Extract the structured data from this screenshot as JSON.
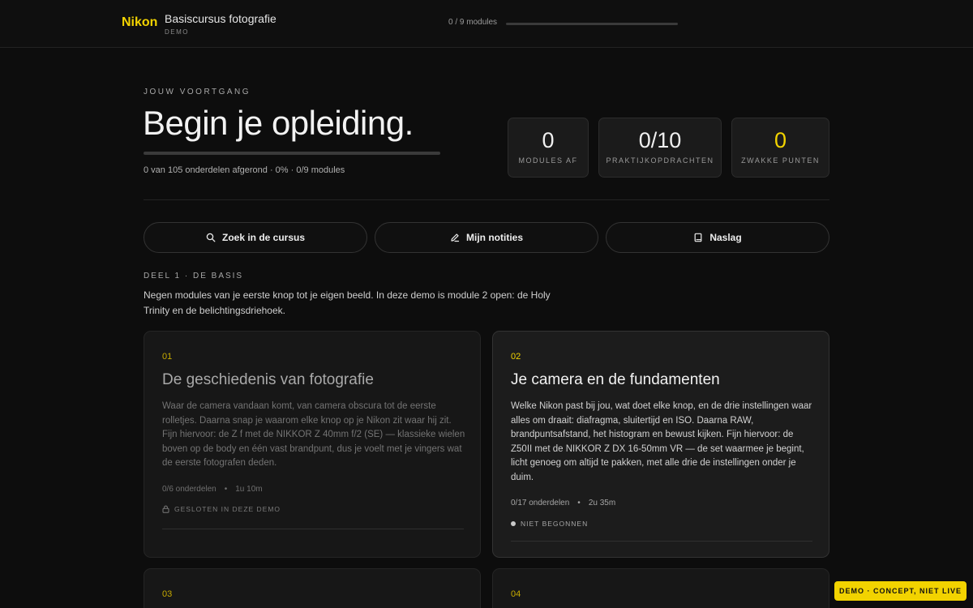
{
  "header": {
    "brand": "Nikon",
    "course_title": "Basiscursus fotografie",
    "course_sub": "DEMO",
    "progress_label": "0 / 9 modules",
    "progress_fraction": 0
  },
  "hero": {
    "eyebrow": "JOUW VOORTGANG",
    "title": "Begin je opleiding.",
    "progress_fraction": 0,
    "summary": "0 van 105 onderdelen afgerond · 0% · 0/9 modules"
  },
  "stats": [
    {
      "value": "0",
      "label": "MODULES AF"
    },
    {
      "value": "0/10",
      "label": "PRAKTIJKOPDRACHTEN"
    },
    {
      "value": "0",
      "label": "ZWAKKE PUNTEN"
    }
  ],
  "actions": {
    "search": "Zoek in de cursus",
    "notes": "Mijn notities",
    "reference": "Naslag"
  },
  "part": {
    "label": "DEEL 1 · DE BASIS",
    "description": "Negen modules van je eerste knop tot je eigen beeld. In deze demo is module 2 open: de Holy Trinity en de belichtingsdriehoek."
  },
  "modules": [
    {
      "number": "01",
      "title": "De geschiedenis van fotografie",
      "description": "Waar de camera vandaan komt, van camera obscura tot de eerste rolletjes. Daarna snap je waarom elke knop op je Nikon zit waar hij zit. Fijn hiervoor: de Z f met de NIKKOR Z 40mm f/2 (SE) — klassieke wielen boven op de body en één vast brandpunt, dus je voelt met je vingers wat de eerste fotografen deden.",
      "parts": "0/6 onderdelen",
      "duration": "1u 10m",
      "status": "GESLOTEN IN DEZE DEMO"
    },
    {
      "number": "02",
      "title": "Je camera en de fundamenten",
      "description": "Welke Nikon past bij jou, wat doet elke knop, en de drie instellingen waar alles om draait: diafragma, sluitertijd en ISO. Daarna RAW, brandpuntsafstand, het histogram en bewust kijken. Fijn hiervoor: de Z50II met de NIKKOR Z DX 16-50mm VR — de set waarmee je begint, licht genoeg om altijd te pakken, met alle drie de instellingen onder je duim.",
      "parts": "0/17 onderdelen",
      "duration": "2u 35m",
      "status": "NIET BEGONNEN"
    },
    {
      "number": "03"
    },
    {
      "number": "04"
    }
  ],
  "demo_badge": "DEMO · CONCEPT, NIET LIVE",
  "colors": {
    "accent": "#f2d300",
    "background": "#0d0d0d",
    "card": "#1c1c1c"
  }
}
